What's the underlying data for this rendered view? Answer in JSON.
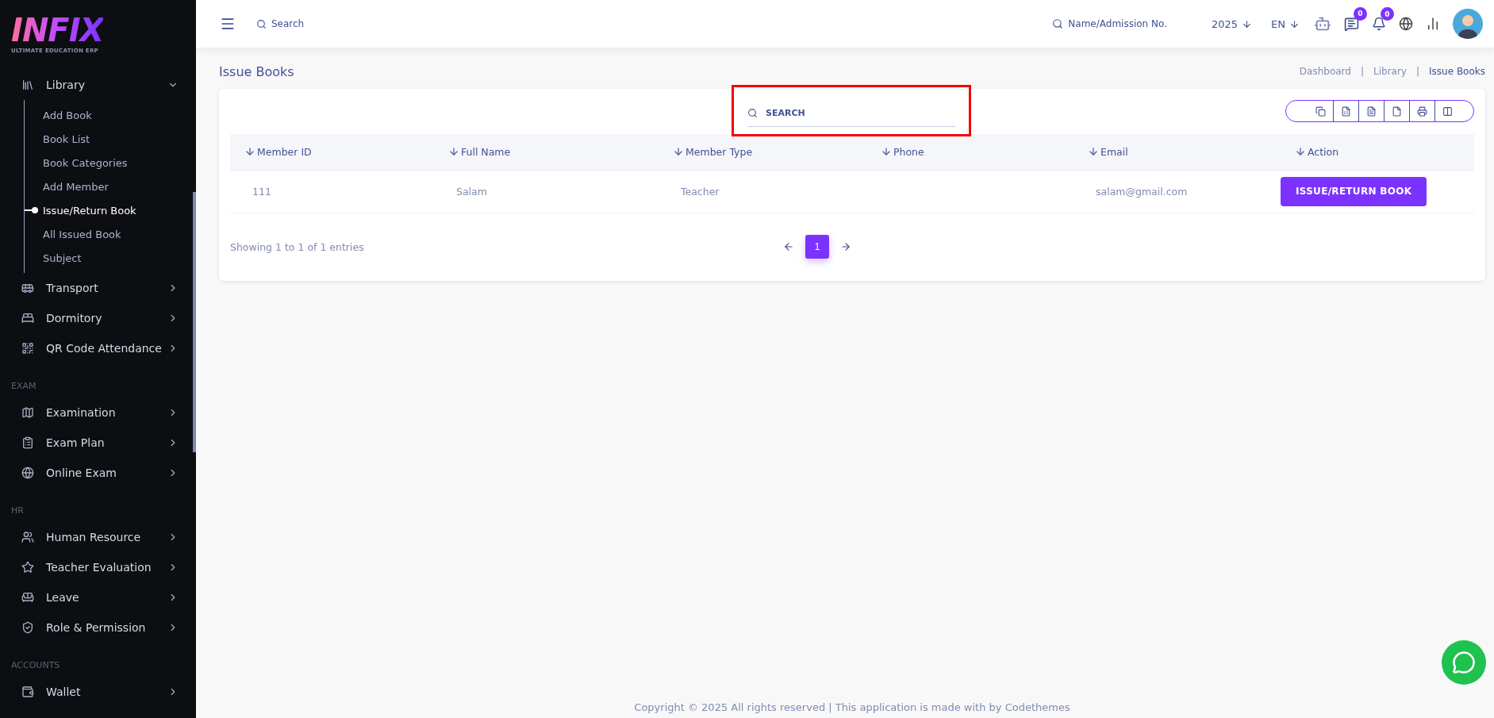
{
  "logo": {
    "name": "INFIX",
    "tagline": "ULTIMATE EDUCATION ERP"
  },
  "sidebar": {
    "sections": [
      {
        "items": [
          {
            "label": "Library",
            "expanded": true,
            "children": [
              {
                "label": "Add Book",
                "selected": false
              },
              {
                "label": "Book List",
                "selected": false
              },
              {
                "label": "Book Categories",
                "selected": false
              },
              {
                "label": "Add Member",
                "selected": false
              },
              {
                "label": "Issue/Return Book",
                "selected": true
              },
              {
                "label": "All Issued Book",
                "selected": false
              },
              {
                "label": "Subject",
                "selected": false
              }
            ]
          },
          {
            "label": "Transport",
            "expanded": false
          },
          {
            "label": "Dormitory",
            "expanded": false
          },
          {
            "label": "QR Code Attendance",
            "expanded": false
          }
        ]
      },
      {
        "title": "EXAM",
        "items": [
          {
            "label": "Examination",
            "expanded": false
          },
          {
            "label": "Exam Plan",
            "expanded": false
          },
          {
            "label": "Online Exam",
            "expanded": false
          }
        ]
      },
      {
        "title": "HR",
        "items": [
          {
            "label": "Human Resource",
            "expanded": false
          },
          {
            "label": "Teacher Evaluation",
            "expanded": false
          },
          {
            "label": "Leave",
            "expanded": false
          },
          {
            "label": "Role & Permission",
            "expanded": false
          }
        ]
      },
      {
        "title": "ACCOUNTS",
        "items": [
          {
            "label": "Wallet",
            "expanded": false
          }
        ]
      }
    ]
  },
  "topbar": {
    "search_placeholder": "Search",
    "student_search_placeholder": "Name/Admission No.",
    "year": "2025",
    "language": "EN",
    "message_count": "0",
    "notification_count": "0"
  },
  "page": {
    "title": "Issue Books",
    "breadcrumb": [
      {
        "kind": "link",
        "text": "Dashboard"
      },
      {
        "kind": "separator",
        "text": "|"
      },
      {
        "kind": "link",
        "text": "Library"
      },
      {
        "kind": "separator",
        "text": "|"
      },
      {
        "kind": "current",
        "text": "Issue Books"
      }
    ]
  },
  "table_search": {
    "placeholder": "SEARCH",
    "highlighted": true
  },
  "table": {
    "columns": [
      "Member ID",
      "Full Name",
      "Member Type",
      "Phone",
      "Email",
      "Action"
    ],
    "rows": [
      {
        "cells": [
          "111",
          "Salam",
          "Teacher",
          "",
          "salam@gmail.com"
        ],
        "action": "ISSUE/RETURN BOOK"
      }
    ]
  },
  "pagination": {
    "summary": "Showing 1 to 1 of 1 entries",
    "pages": [
      {
        "label": "1",
        "selected": true
      }
    ]
  },
  "footer": "Copyright © 2025 All rights reserved | This application is made with by Codethemes"
}
